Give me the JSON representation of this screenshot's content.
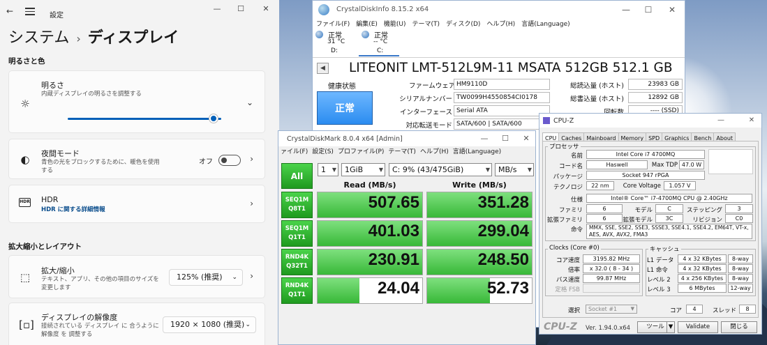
{
  "settings": {
    "window_title": "設定",
    "breadcrumb_parent": "システム",
    "breadcrumb_sep": "›",
    "breadcrumb_current": "ディスプレイ",
    "section_brightness": "明るさと色",
    "brightness_title": "明るさ",
    "brightness_desc": "内蔵ディスプレイの明るさを調整する",
    "brightness_level": 0.95,
    "night_title": "夜間モード",
    "night_desc": "青色の光をブロックするために、暖色を使用する",
    "night_state": "オフ",
    "hdr_title": "HDR",
    "hdr_link": "HDR に関する詳細情報",
    "hdr_icon_text": "HDR",
    "section_scale": "拡大縮小とレイアウト",
    "scale_title": "拡大/縮小",
    "scale_desc": "テキスト、アプリ、その他の項目のサイズを変更します",
    "scale_value": "125% (推奨)",
    "res_title": "ディスプレイの解像度",
    "res_desc": "接続されている ディスプレイ に 合うように 解像度 を 調整する",
    "res_value": "1920 × 1080 (推奨)"
  },
  "cdi": {
    "window_title": "CrystalDiskInfo 8.15.2 x64",
    "menu": [
      "ファイル(F)",
      "編集(E)",
      "機能(U)",
      "テーマ(T)",
      "ディスク(D)",
      "ヘルプ(H)",
      "言語(Language)"
    ],
    "drives": [
      {
        "status": "正常",
        "temp": "31 °C",
        "letter": "D:"
      },
      {
        "status": "正常",
        "temp": "-- °C",
        "letter": "C:"
      }
    ],
    "model": "LITEONIT LMT-512L9M-11 MSATA 512GB 512.1 GB",
    "health_label": "健康状態",
    "health_value": "正常",
    "firmware_label": "ファームウェア",
    "firmware": "HM9110D",
    "serial_label": "シリアルナンバー",
    "serial": "TW0099H4550854CI0178",
    "interface_label": "インターフェース",
    "interface": "Serial ATA",
    "transfer_label": "対応転送モード",
    "transfer": "SATA/600 | SATA/600",
    "read_total_label": "総読込量 (ホスト)",
    "read_total": "23983 GB",
    "write_total_label": "総書込量 (ホスト)",
    "write_total": "12892 GB",
    "rpm_label": "回転数",
    "rpm": "---- (SSD)"
  },
  "cdm": {
    "window_title": "CrystalDiskMark 8.0.4 x64 [Admin]",
    "menu": [
      "ァイル(F)",
      "設定(S)",
      "プロファイル(P)",
      "テーマ(T)",
      "ヘルプ(H)",
      "言語(Language)"
    ],
    "all_label": "All",
    "count": "1",
    "size": "1GiB",
    "drive": "C: 9% (43/475GiB)",
    "unit": "MB/s",
    "read_header": "Read (MB/s)",
    "write_header": "Write (MB/s)",
    "tests": [
      {
        "l1": "SEQ1M",
        "l2": "Q8T1",
        "read": "507.65",
        "write": "351.28",
        "read_fill": 1.0,
        "write_fill": 1.0
      },
      {
        "l1": "SEQ1M",
        "l2": "Q1T1",
        "read": "401.03",
        "write": "299.04",
        "read_fill": 1.0,
        "write_fill": 1.0
      },
      {
        "l1": "RND4K",
        "l2": "Q32T1",
        "read": "230.91",
        "write": "248.50",
        "read_fill": 1.0,
        "write_fill": 1.0
      },
      {
        "l1": "RND4K",
        "l2": "Q1T1",
        "read": "24.04",
        "write": "52.73",
        "read_fill": 0.4,
        "write_fill": 0.6
      }
    ]
  },
  "cpuz": {
    "window_title": "CPU-Z",
    "tabs": [
      "CPU",
      "Caches",
      "Mainboard",
      "Memory",
      "SPD",
      "Graphics",
      "Bench",
      "About"
    ],
    "processor_group": "プロセッサ",
    "name_label": "名前",
    "name": "Intel Core i7 4700MQ",
    "codename_label": "コード名",
    "codename": "Haswell",
    "maxtdp_label": "Max TDP",
    "maxtdp": "47.0 W",
    "package_label": "パッケージ",
    "package": "Socket 947 rPGA",
    "tech_label": "テクノロジ",
    "tech": "22 nm",
    "cv_label": "Core Voltage",
    "cv": "1.057 V",
    "spec_label": "仕様",
    "spec": "Intel® Core™ i7-4700MQ CPU @ 2.40GHz",
    "family_label": "ファミリ",
    "family": "6",
    "model_label": "モデル",
    "model": "C",
    "stepping_label": "ステッピング",
    "stepping": "3",
    "extfamily_label": "拡張ファミリ",
    "extfamily": "6",
    "extmodel_label": "拡張モデル",
    "extmodel": "3C",
    "revision_label": "リビジョン",
    "revision": "C0",
    "instr_label": "命令",
    "instr": "MMX, SSE, SSE2, SSE3, SSSE3, SSE4.1, SSE4.2, EM64T, VT-x, AES, AVX, AVX2, FMA3",
    "clocks_group": "Clocks (Core #0)",
    "corespeed_label": "コア速度",
    "corespeed": "3195.82 MHz",
    "mult_label": "倍率",
    "mult": "x 32.0 ( 8 - 34 )",
    "bus_label": "バス速度",
    "bus": "99.87 MHz",
    "fsb_label": "定格 FSB",
    "cache_group": "キャッシュ",
    "cache": [
      {
        "label": "L1 データ",
        "size": "4 x 32 KBytes",
        "way": "8-way"
      },
      {
        "label": "L1 命令",
        "size": "4 x 32 KBytes",
        "way": "8-way"
      },
      {
        "label": "レベル 2",
        "size": "4 x 256 KBytes",
        "way": "8-way"
      },
      {
        "label": "レベル 3",
        "size": "6 MBytes",
        "way": "12-way"
      }
    ],
    "select_label": "選択",
    "select_value": "Socket #1",
    "cores_label": "コア",
    "cores": "4",
    "threads_label": "スレッド",
    "threads": "8",
    "logo": "CPU-Z",
    "version": "Ver. 1.94.0.x64",
    "tool_btn": "ツール",
    "validate_btn": "Validate",
    "close_btn": "閉じる"
  }
}
